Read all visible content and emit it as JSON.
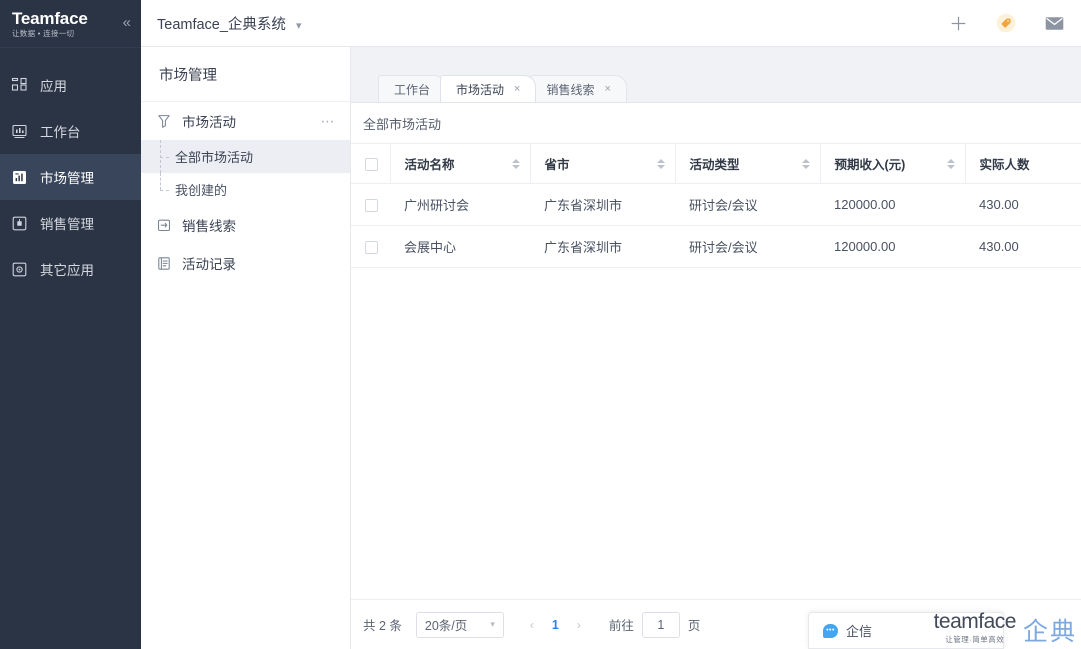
{
  "brand": {
    "name": "Teamface",
    "subtitle": "让数据 • 连接一切",
    "collapse_icon": "double-chevron-left-icon"
  },
  "sidebar": {
    "items": [
      {
        "label": "应用",
        "icon": "apps-grid-icon",
        "active": false
      },
      {
        "label": "工作台",
        "icon": "dashboard-icon",
        "active": false
      },
      {
        "label": "市场管理",
        "icon": "market-chart-icon",
        "active": true
      },
      {
        "label": "销售管理",
        "icon": "sales-box-icon",
        "active": false
      },
      {
        "label": "其它应用",
        "icon": "other-apps-icon",
        "active": false
      }
    ]
  },
  "topbar": {
    "workspace": "Teamface_企典系统",
    "caret_icon": "chevron-down-icon",
    "actions": [
      {
        "name": "add-icon",
        "glyph": "+"
      },
      {
        "name": "tag-icon",
        "glyph": "tag"
      },
      {
        "name": "mail-icon",
        "glyph": "mail"
      }
    ]
  },
  "modulebar": {
    "title": "市场管理",
    "group": {
      "label": "市场活动",
      "icon": "funnel-icon",
      "more_icon": "more-horizontal-icon"
    },
    "sub_items": [
      {
        "label": "全部市场活动",
        "active": true
      },
      {
        "label": "我创建的",
        "active": false
      }
    ],
    "items": [
      {
        "label": "销售线索",
        "icon": "leads-icon"
      },
      {
        "label": "活动记录",
        "icon": "records-icon"
      }
    ]
  },
  "tabs": [
    {
      "label": "工作台",
      "active": false,
      "closable": false
    },
    {
      "label": "市场活动",
      "active": true,
      "closable": true
    },
    {
      "label": "销售线索",
      "active": false,
      "closable": true
    }
  ],
  "tab_close_glyph": "×",
  "card": {
    "title": "全部市场活动"
  },
  "table": {
    "columns": [
      {
        "label": "活动名称",
        "sortable": true
      },
      {
        "label": "省市",
        "sortable": true
      },
      {
        "label": "活动类型",
        "sortable": true
      },
      {
        "label": "预期收入(元)",
        "sortable": true
      },
      {
        "label": "实际人数",
        "sortable": false
      }
    ],
    "rows": [
      {
        "name": "广州研讨会",
        "province_city": "广东省深圳市",
        "type": "研讨会/会议",
        "expected_income": "120000.00",
        "actual_people": "430.00"
      },
      {
        "name": "会展中心",
        "province_city": "广东省深圳市",
        "type": "研讨会/会议",
        "expected_income": "120000.00",
        "actual_people": "430.00"
      }
    ]
  },
  "pagination": {
    "total_text": "共 2 条",
    "page_size": "20条/页",
    "page_size_caret": "chevron-down-icon",
    "prev_glyph": "‹",
    "next_glyph": "›",
    "current_page": "1",
    "jump_prefix": "前往",
    "jump_value": "1",
    "jump_suffix": "页"
  },
  "chat_widget": {
    "label": "企信",
    "bubble_text": "•••"
  },
  "watermark": {
    "name": "teamface",
    "subtitle": "让管理·简单高效",
    "cn": "企典"
  },
  "colors": {
    "sidebar_bg": "#2b3445",
    "sidebar_active": "#39455a",
    "accent_blue": "#2f7cf6",
    "tag_orange": "#f0a63c",
    "content_bg": "#f0f2f5"
  }
}
